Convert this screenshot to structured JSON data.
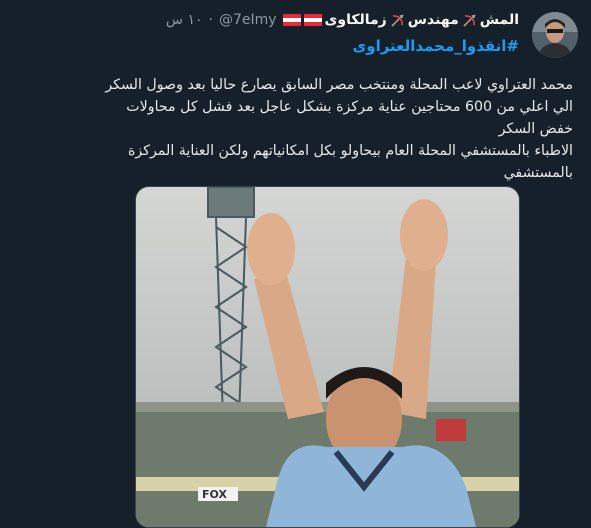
{
  "author": {
    "display_name": "المش",
    "title_word": "مهندس",
    "club_word": "زمالكاوى",
    "handle": "@7eImy",
    "separator": "·",
    "time": "١٠ س"
  },
  "hashtag": "#انقذوا_محمدالعتراوى",
  "tweet": {
    "lines": [
      "محمد العتراوي  لاعب المحلة ومنتخب مصر السابق يصارع  حاليا بعد وصول السكر",
      "الي اعلي من 600 محتاجين عناية مركزة بشكل عاجل بعد فشل كل محاولات",
      "خفض السكر",
      "الاطباء بالمستشفي المحلة العام بيحاولو بكل امكانياتهم ولكن العناية المركزة",
      "بالمستشفي"
    ]
  },
  "media": {
    "banner_text": "FOX",
    "colors": {
      "jersey": "#8fb6d8",
      "sky": "#c9ccca"
    }
  },
  "colors": {
    "background": "#15202b",
    "accent": "#1d9bf0",
    "muted": "#8b98a5"
  },
  "icons": [
    "bow-and-arrow-icon",
    "austria-flag-icon",
    "avatar-image"
  ]
}
